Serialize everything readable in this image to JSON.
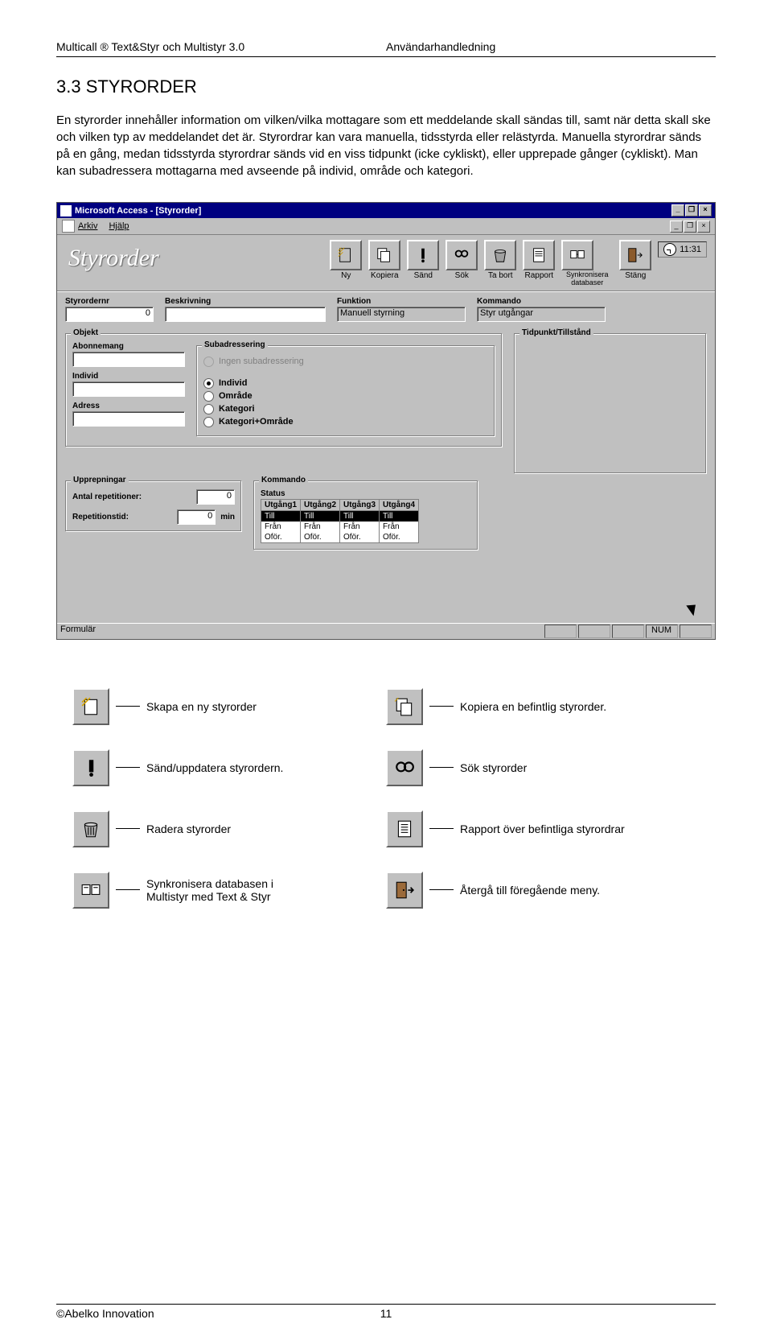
{
  "header": {
    "left": "Multicall ® Text&Styr och Multistyr 3.0",
    "right": "Användarhandledning"
  },
  "section": {
    "number_title": "3.3  STYRORDER",
    "body": "En styrorder innehåller information om vilken/vilka mottagare som ett meddelande skall sändas till, samt när detta skall ske och vilken typ av meddelandet det är. Styrordrar kan vara manuella, tidsstyrda eller relästyrda. Manuella styrordrar sänds på en gång, medan tidsstyrda styrordrar sänds vid en viss tidpunkt (icke cykliskt), eller upprepade gånger (cykliskt). Man kan subadressera mottagarna med avseende på individ, område och kategori."
  },
  "access_window": {
    "title": "Microsoft Access - [Styrorder]",
    "menus": {
      "m1": "Arkiv",
      "m2": "Hjälp"
    },
    "app_header": "Styrorder",
    "clock": "11:31",
    "toolbar": {
      "ny": "Ny",
      "kopiera": "Kopiera",
      "sand": "Sänd",
      "sok": "Sök",
      "tabort": "Ta bort",
      "rapport": "Rapport",
      "synk": "Synkronisera databaser",
      "stang": "Stäng"
    },
    "fields": {
      "styrordernr_label": "Styrordernr",
      "styrordernr_value": "0",
      "beskrivning_label": "Beskrivning",
      "beskrivning_value": "",
      "funktion_label": "Funktion",
      "funktion_value": "Manuell styrning",
      "kommando_label": "Kommando",
      "kommando_value": "Styr utgångar"
    },
    "objekt": {
      "legend": "Objekt",
      "abonnemang": "Abonnemang",
      "individ": "Individ",
      "adress": "Adress",
      "sub_legend": "Subadressering",
      "sub_none": "Ingen subadressering",
      "sub_individ": "Individ",
      "sub_omrade": "Område",
      "sub_kategori": "Kategori",
      "sub_katomr": "Kategori+Område"
    },
    "tidpunkt_legend": "Tidpunkt/Tillstånd",
    "upprepningar": {
      "legend": "Upprepningar",
      "antal_label": "Antal repetitioner:",
      "antal_value": "0",
      "reptid_label": "Repetitionstid:",
      "reptid_value": "0",
      "reptid_unit": "min"
    },
    "kommando": {
      "legend": "Kommando",
      "status": "Status",
      "cols": [
        "Utgång1",
        "Utgång2",
        "Utgång3",
        "Utgång4"
      ],
      "rows_label": [
        "Till",
        "Från",
        "Oför."
      ],
      "rows": [
        [
          "Till",
          "Till",
          "Till",
          "Till"
        ],
        [
          "Från",
          "Från",
          "Från",
          "Från"
        ],
        [
          "Oför.",
          "Oför.",
          "Oför.",
          "Oför."
        ]
      ]
    },
    "statusbar": {
      "left": "Formulär",
      "num": "NUM"
    }
  },
  "legend_items": {
    "r1a": "Skapa en ny styrorder",
    "r1b": "Kopiera en befintlig styrorder.",
    "r2a": "Sänd/uppdatera styrordern.",
    "r2b": "Sök styrorder",
    "r3a": "Radera styrorder",
    "r3b": "Rapport över befintliga styrordrar",
    "r4a": "Synkronisera databasen i Multistyr med Text & Styr",
    "r4b": "Återgå till föregående meny."
  },
  "footer": {
    "left": "©Abelko Innovation",
    "page": "11"
  }
}
